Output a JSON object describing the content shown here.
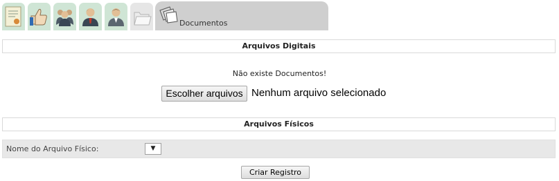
{
  "tabs": {
    "icons": [
      "certificate-icon",
      "thumbs-up-icon",
      "group-icon",
      "user-icon",
      "person-icon",
      "folder-icon"
    ],
    "active_label": "Documentos"
  },
  "digital": {
    "title": "Arquivos Digitais",
    "empty_message": "Não existe Documentos!",
    "choose_button": "Escolher arquivos",
    "no_file_text": "Nenhum arquivo selecionado"
  },
  "physical": {
    "title": "Arquivos Físicos",
    "field_label": "Nome do Arquivo Físico:",
    "select_arrow": "▼",
    "create_button": "Criar Registro"
  }
}
